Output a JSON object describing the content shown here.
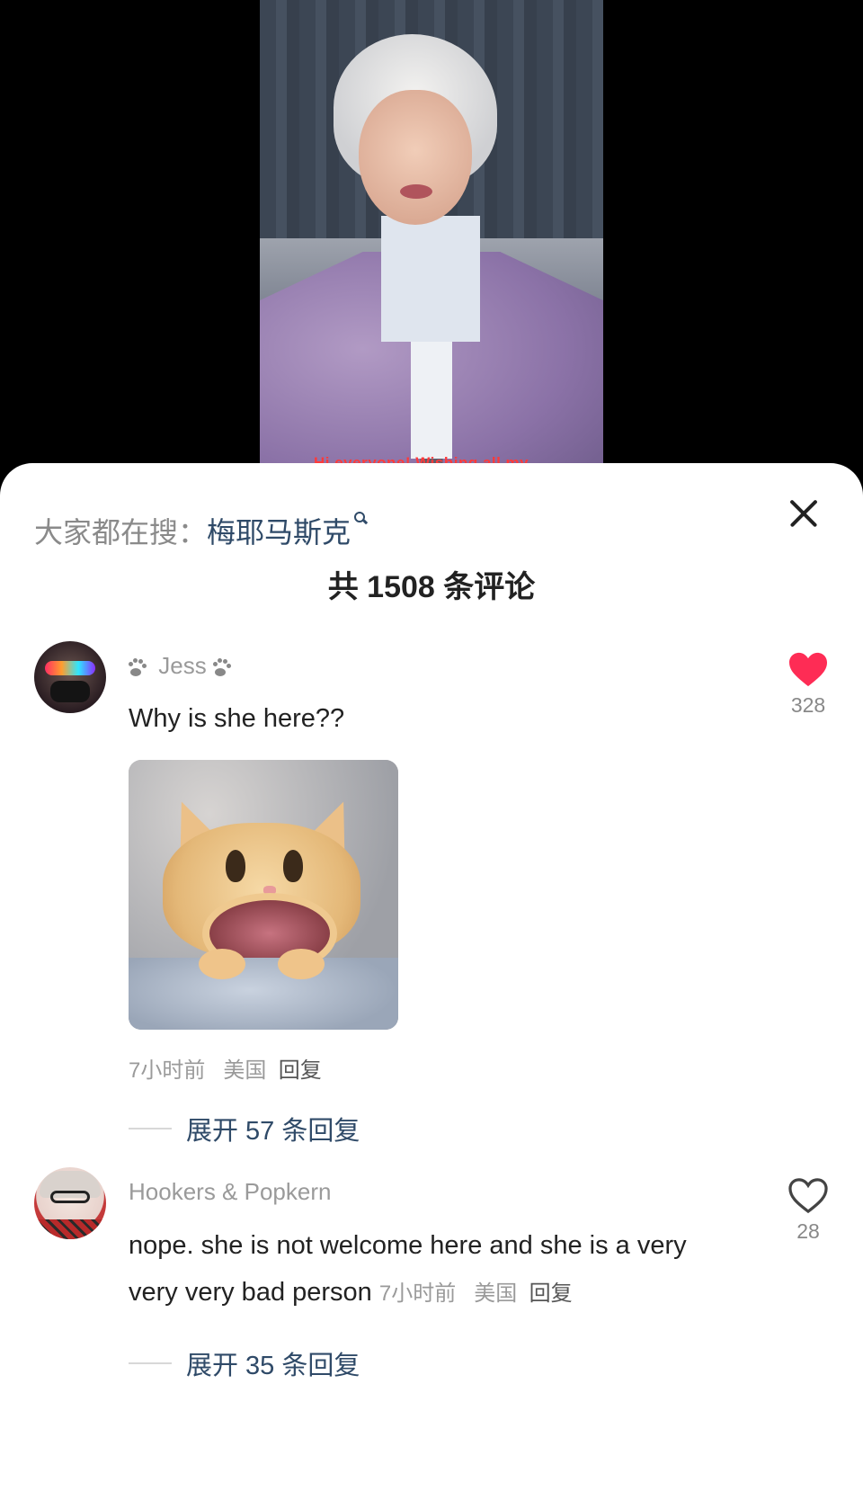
{
  "video": {
    "caption": "Hi everyone! Wishing all my..."
  },
  "sheet": {
    "search_prefix": "大家都在搜：",
    "search_keyword": "梅耶马斯克",
    "comment_count_label": "共 1508 条评论"
  },
  "comments": [
    {
      "username": "Jess",
      "text": "Why is she here??",
      "time": "7小时前",
      "location": "美国",
      "reply_label": "回复",
      "likes": "328",
      "liked": true,
      "expand_label": "展开 57 条回复"
    },
    {
      "username": "Hookers & Popkern",
      "text": "nope. she is not welcome here and she is a very very very bad person",
      "time": "7小时前",
      "location": "美国",
      "reply_label": "回复",
      "likes": "28",
      "liked": false,
      "expand_label": "展开 35 条回复"
    }
  ],
  "colors": {
    "like_active": "#fe2c55",
    "link_blue": "#2f4a68",
    "muted_text": "#9a9a9a"
  },
  "icons": {
    "close": "close-icon",
    "search": "search-icon",
    "like": "heart-icon",
    "username_decor": "paw-icon"
  }
}
